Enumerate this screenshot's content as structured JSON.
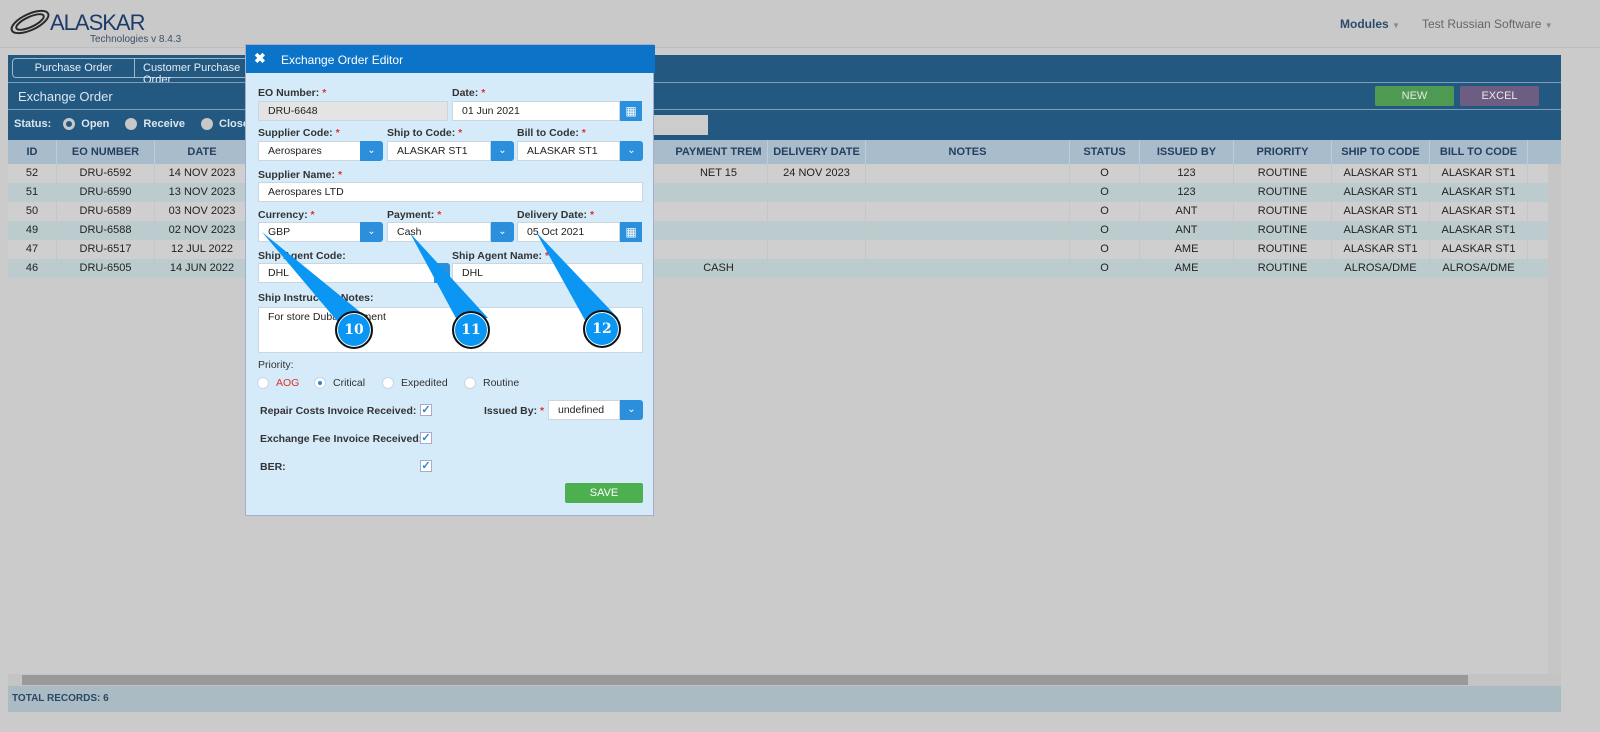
{
  "header": {
    "logo": "ALASKAR",
    "logo_sub": "Technologies",
    "version": "v 8.4.3",
    "modules": "Modules",
    "user": "Test Russian Software"
  },
  "tabs": [
    "Purchase Order",
    "Customer Purchase Order"
  ],
  "page_title": "Exchange Order",
  "buttons": {
    "new": "NEW",
    "excel": "EXCEL"
  },
  "status": {
    "label": "Status:",
    "options": [
      "Open",
      "Receive",
      "Close"
    ],
    "selected": "Open"
  },
  "columns_left": [
    "ID",
    "EO NUMBER",
    "DATE"
  ],
  "columns_right": [
    "PAYMENT TREM",
    "DELIVERY DATE",
    "NOTES",
    "STATUS",
    "ISSUED BY",
    "PRIORITY",
    "SHIP TO CODE",
    "BILL TO CODE"
  ],
  "rows": [
    {
      "id": "52",
      "eo": "DRU-6592",
      "date": "14 NOV 2023",
      "payment": "NET 15",
      "delivery": "24 NOV 2023",
      "notes": "",
      "status": "O",
      "issued": "123",
      "priority": "ROUTINE",
      "ship": "ALASKAR ST1",
      "bill": "ALASKAR ST1"
    },
    {
      "id": "51",
      "eo": "DRU-6590",
      "date": "13 NOV 2023",
      "payment": "",
      "delivery": "",
      "notes": "",
      "status": "O",
      "issued": "123",
      "priority": "ROUTINE",
      "ship": "ALASKAR ST1",
      "bill": "ALASKAR ST1"
    },
    {
      "id": "50",
      "eo": "DRU-6589",
      "date": "03 NOV 2023",
      "payment": "",
      "delivery": "",
      "notes": "",
      "status": "O",
      "issued": "ANT",
      "priority": "ROUTINE",
      "ship": "ALASKAR ST1",
      "bill": "ALASKAR ST1"
    },
    {
      "id": "49",
      "eo": "DRU-6588",
      "date": "02 NOV 2023",
      "payment": "",
      "delivery": "",
      "notes": "",
      "status": "O",
      "issued": "ANT",
      "priority": "ROUTINE",
      "ship": "ALASKAR ST1",
      "bill": "ALASKAR ST1"
    },
    {
      "id": "47",
      "eo": "DRU-6517",
      "date": "12 JUL 2022",
      "payment": "",
      "delivery": "",
      "notes": "",
      "status": "O",
      "issued": "AME",
      "priority": "ROUTINE",
      "ship": "ALASKAR ST1",
      "bill": "ALASKAR ST1"
    },
    {
      "id": "46",
      "eo": "DRU-6505",
      "date": "14 JUN 2022",
      "payment": "CASH",
      "delivery": "",
      "notes": "",
      "status": "O",
      "issued": "AME",
      "priority": "ROUTINE",
      "ship": "ALROSA/DME",
      "bill": "ALROSA/DME"
    }
  ],
  "footer": {
    "total": "TOTAL RECORDS: 6"
  },
  "modal": {
    "title": "Exchange Order Editor",
    "eo_number_label": "EO Number:",
    "eo_number": "DRU-6648",
    "date_label": "Date:",
    "date": "01 Jun 2021",
    "supplier_code_label": "Supplier Code:",
    "supplier_code": "Aerospares",
    "ship_to_label": "Ship to Code:",
    "ship_to": "ALASKAR ST1",
    "bill_to_label": "Bill to Code:",
    "bill_to": "ALASKAR ST1",
    "supplier_name_label": "Supplier Name:",
    "supplier_name": "Aerospares LTD",
    "currency_label": "Currency:",
    "currency": "GBP",
    "payment_label": "Payment:",
    "payment": "Cash",
    "delivery_label": "Delivery Date:",
    "delivery": "05 Oct 2021",
    "agent_code_label": "Ship Agent Code:",
    "agent_code": "DHL",
    "agent_name_label": "Ship Agent Name:",
    "agent_name": "DHL",
    "notes_label": "Ship Instruction Notes:",
    "notes": "For store Dubai shipment",
    "priority_label": "Priority:",
    "priorities": [
      "AOG",
      "Critical",
      "Expedited",
      "Routine"
    ],
    "priority_selected": "Critical",
    "repair_label": "Repair Costs Invoice Received:",
    "repair": true,
    "fee_label": "Exchange Fee Invoice Received:",
    "fee": true,
    "ber_label": "BER:",
    "ber": true,
    "issued_label": "Issued By:",
    "issued": "undefined",
    "save": "SAVE",
    "req": "*"
  },
  "annotations": [
    "10",
    "11",
    "12"
  ],
  "colors": {
    "accent": "#0b74c9",
    "panel": "#235981",
    "save": "#4caf50"
  }
}
